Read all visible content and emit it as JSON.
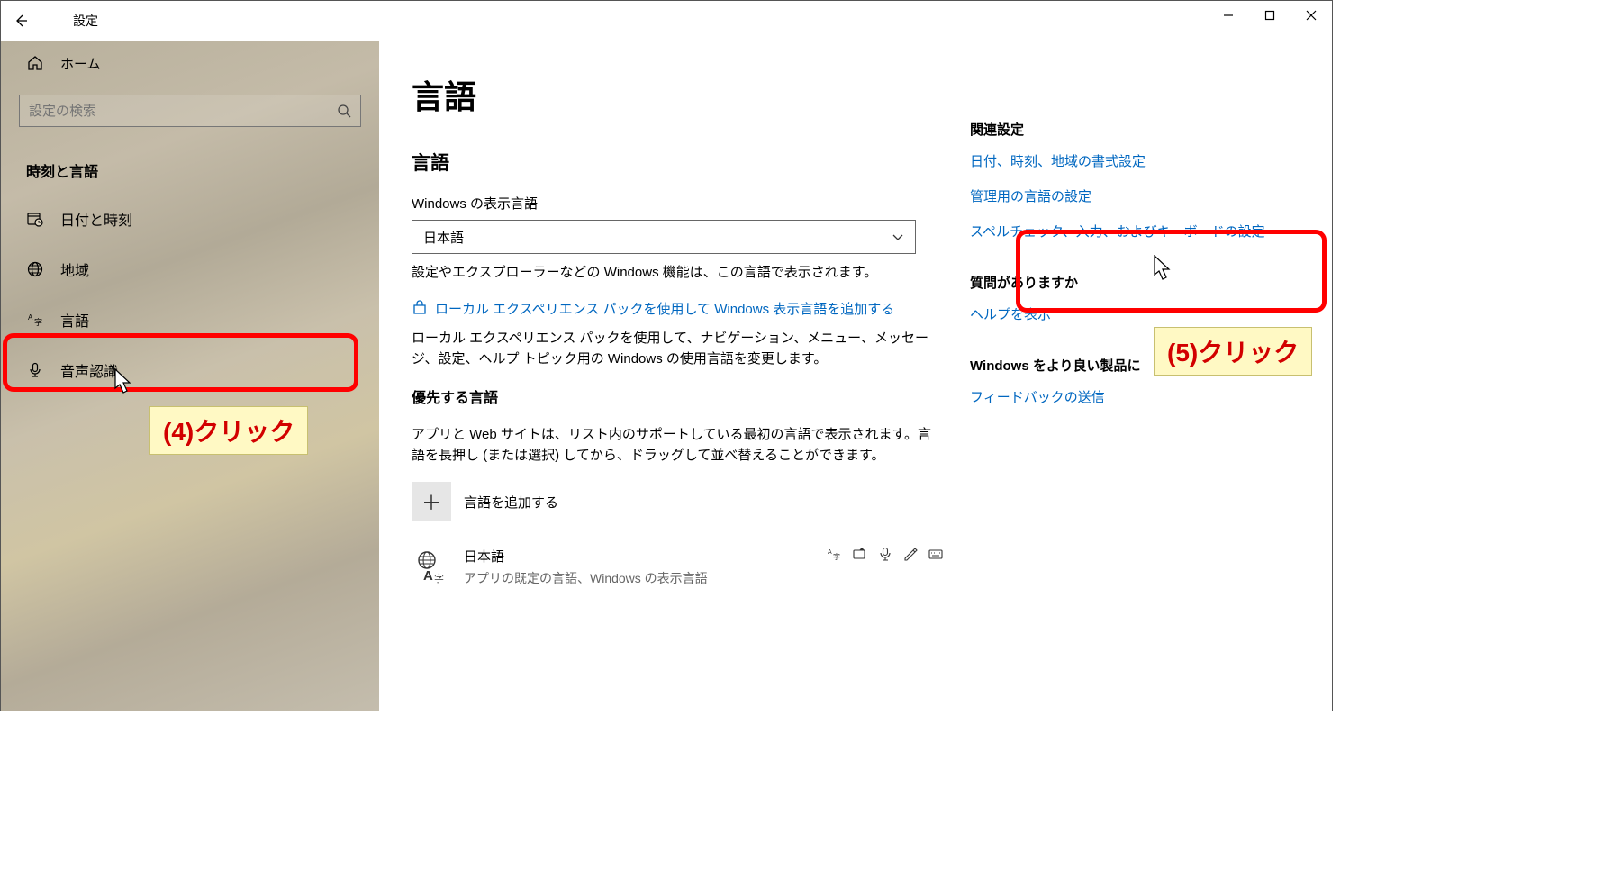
{
  "titlebar": {
    "title": "設定"
  },
  "sidebar": {
    "home": "ホーム",
    "search_placeholder": "設定の検索",
    "category_header": "時刻と言語",
    "items": [
      {
        "id": "date-time",
        "label": "日付と時刻"
      },
      {
        "id": "region",
        "label": "地域"
      },
      {
        "id": "language",
        "label": "言語"
      },
      {
        "id": "speech",
        "label": "音声認識"
      }
    ]
  },
  "main": {
    "heading": "言語",
    "section1_heading": "言語",
    "display_label": "Windows の表示言語",
    "display_value": "日本語",
    "display_desc": "設定やエクスプローラーなどの Windows 機能は、この言語で表示されます。",
    "store_link": "ローカル エクスペリエンス パックを使用して Windows 表示言語を追加する",
    "store_desc": "ローカル エクスペリエンス パックを使用して、ナビゲーション、メニュー、メッセージ、設定、ヘルプ トピック用の Windows の使用言語を変更します。",
    "preferred_heading": "優先する言語",
    "preferred_desc": "アプリと Web サイトは、リスト内のサポートしている最初の言語で表示されます。言語を長押し (または選択) してから、ドラッグして並べ替えることができます。",
    "add_language": "言語を追加する",
    "lang": {
      "name": "日本語",
      "sub": "アプリの既定の言語、Windows の表示言語"
    }
  },
  "rail": {
    "related_heading": "関連設定",
    "link_date_region": "日付、時刻、地域の書式設定",
    "link_admin": "管理用の言語の設定",
    "link_spell": "スペルチェック、入力、およびキーボードの設定",
    "question_heading": "質問がありますか",
    "link_help": "ヘルプを表示",
    "improve_heading": "Windows をより良い製品に",
    "link_feedback": "フィードバックの送信"
  },
  "annotations": {
    "step4": "(4)クリック",
    "step5": "(5)クリック"
  }
}
